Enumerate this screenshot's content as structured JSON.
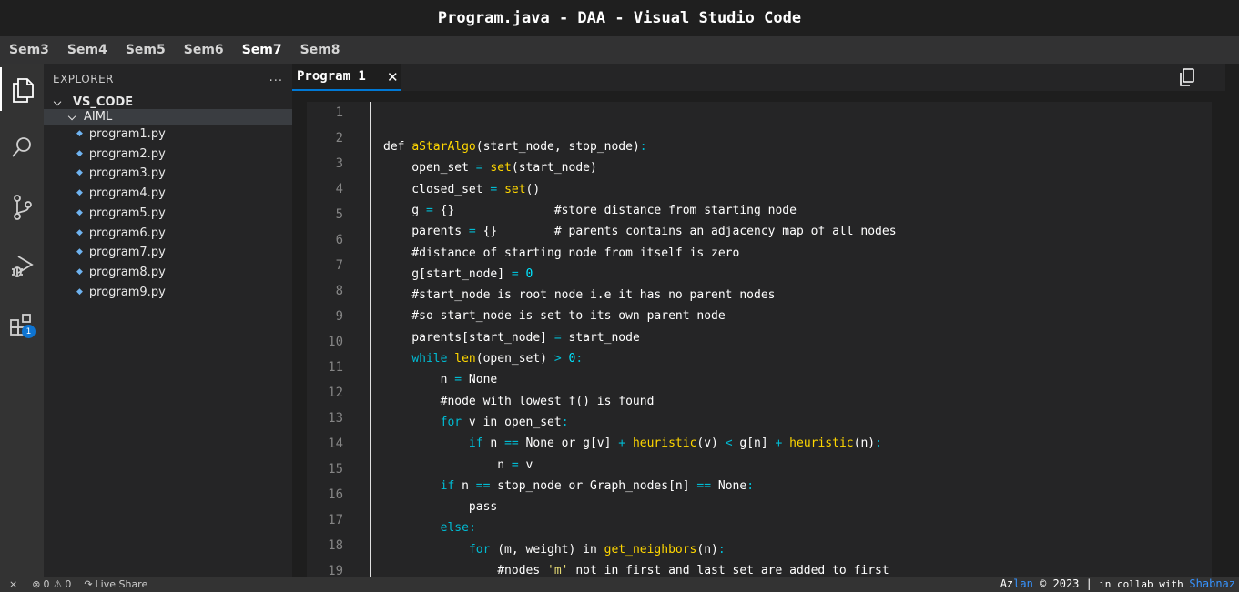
{
  "window": {
    "title": "Program.java - DAA - Visual Studio Code"
  },
  "sem_tabs": [
    {
      "label": "Sem3",
      "active": false
    },
    {
      "label": "Sem4",
      "active": false
    },
    {
      "label": "Sem5",
      "active": false
    },
    {
      "label": "Sem6",
      "active": false
    },
    {
      "label": "Sem7",
      "active": true
    },
    {
      "label": "Sem8",
      "active": false
    }
  ],
  "activity_bar": {
    "icons": [
      "files-icon",
      "search-icon",
      "source-control-icon",
      "run-debug-icon",
      "extensions-icon"
    ],
    "extensions_badge": "1"
  },
  "explorer": {
    "title": "EXPLORER",
    "more": "...",
    "root_folder": "VS_CODE",
    "sub_folder": "AIML",
    "files": [
      "program1.py",
      "program2.py",
      "program3.py",
      "program4.py",
      "program5.py",
      "program6.py",
      "program7.py",
      "program8.py",
      "program9.py"
    ]
  },
  "editor": {
    "tab_label": "Program 1",
    "tab_close": "✕",
    "line_numbers": [
      "1",
      "2",
      "3",
      "4",
      "5",
      "6",
      "7",
      "8",
      "9",
      "10",
      "11",
      "12",
      "13",
      "14",
      "15",
      "16",
      "17",
      "18",
      "19"
    ],
    "code_lines": [
      "def aStarAlgo(start_node, stop_node):",
      "    open_set = set(start_node)",
      "    closed_set = set()",
      "    g = {}              #store distance from starting node",
      "    parents = {}        # parents contains an adjacency map of all nodes",
      "    #distance of starting node from itself is zero",
      "    g[start_node] = 0",
      "    #start_node is root node i.e it has no parent nodes",
      "    #so start_node is set to its own parent node",
      "    parents[start_node] = start_node",
      "    while len(open_set) > 0:",
      "        n = None",
      "        #node with lowest f() is found",
      "        for v in open_set:",
      "            if n == None or g[v] + heuristic(v) < g[n] + heuristic(n):",
      "                n = v",
      "        if n == stop_node or Graph_nodes[n] == None:",
      "            pass",
      "        else:",
      "            for (m, weight) in get_neighbors(n):",
      "                #nodes 'm' not in first and last set are added to first"
    ]
  },
  "status_bar": {
    "errors": "0",
    "warnings": "0",
    "live_share": "Live Share",
    "credit_name_a": "Az",
    "credit_name_b": "lan",
    "credit_mid": " © 2023 | ",
    "credit_collab": "in collab with ",
    "credit_partner": "Shabnaz"
  },
  "colors": {
    "keyword": "#00bcd4",
    "function": "#ffd700",
    "accent": "#0078d4",
    "badge": "#0e74d1"
  }
}
